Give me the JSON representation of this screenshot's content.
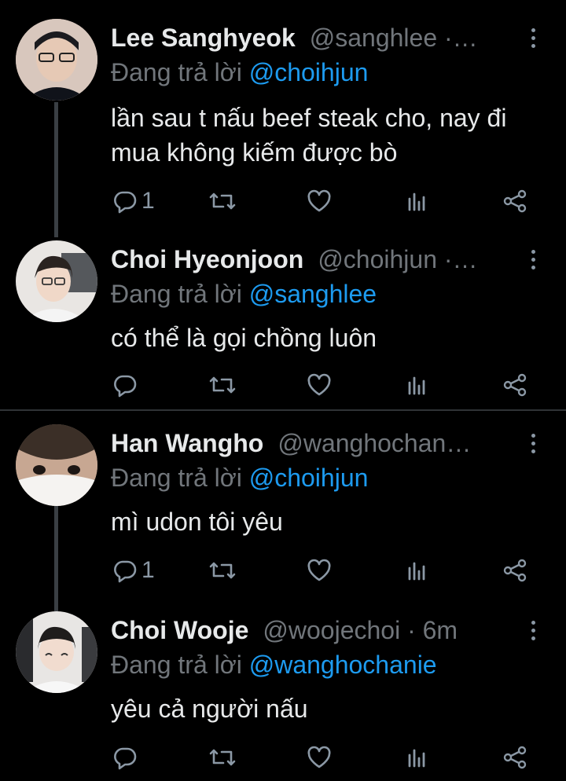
{
  "reply_prefix": "Đang trả lời",
  "tweets": [
    {
      "name": "Lee Sanghyeok",
      "handle": "@sanghlee ·…",
      "reply_to": "@choihjun",
      "text": "lần sau t nấu beef steak cho, nay đi mua không kiếm được bò",
      "reply_count": "1"
    },
    {
      "name": "Choi Hyeonjoon",
      "handle": "@choihjun ·…",
      "reply_to": "@sanghlee",
      "text": "có thể là gọi chồng luôn",
      "reply_count": ""
    },
    {
      "name": "Han Wangho",
      "handle": "@wanghochan…",
      "reply_to": "@choihjun",
      "text": "mì udon tôi yêu",
      "reply_count": "1"
    },
    {
      "name": "Choi Wooje",
      "handle": "@woojechoi · 6m",
      "reply_to": "@wanghochanie",
      "text": "yêu cả người nấu",
      "reply_count": ""
    }
  ],
  "colors": {
    "background": "#000000",
    "name": "#e7e9ea",
    "secondary": "#71767b",
    "mention": "#1d9bf0",
    "icon": "#8b98a5"
  },
  "icons": [
    "reply-icon",
    "retweet-icon",
    "like-icon",
    "analytics-icon",
    "share-icon",
    "more-icon"
  ]
}
